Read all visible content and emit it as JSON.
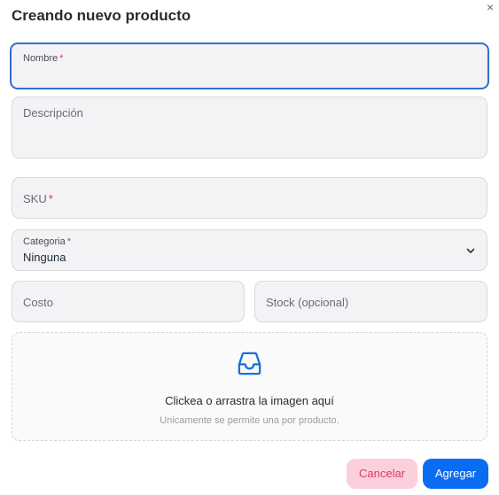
{
  "dialog": {
    "title": "Creando nuevo producto",
    "close_symbol": "×"
  },
  "form": {
    "name": {
      "label": "Nombre",
      "required_mark": "*",
      "value": ""
    },
    "description": {
      "placeholder": "Descripción"
    },
    "sku": {
      "placeholder": "SKU",
      "required_mark": "*"
    },
    "category": {
      "label": "Categoria",
      "required_mark": "*",
      "selected": "Ninguna"
    },
    "cost": {
      "placeholder": "Costo"
    },
    "stock": {
      "placeholder": "Stock (opcional)"
    }
  },
  "upload": {
    "icon": "inbox-icon",
    "title": "Clickea o arrastra la imagen aquí",
    "subtitle": "Unicamente se permite una por producto."
  },
  "actions": {
    "cancel": "Cancelar",
    "add": "Agregar"
  },
  "colors": {
    "accent": "#0a6cf0",
    "required": "#e0345a",
    "cancel_bg": "#fbd0dc",
    "cancel_text": "#d93b6a"
  }
}
